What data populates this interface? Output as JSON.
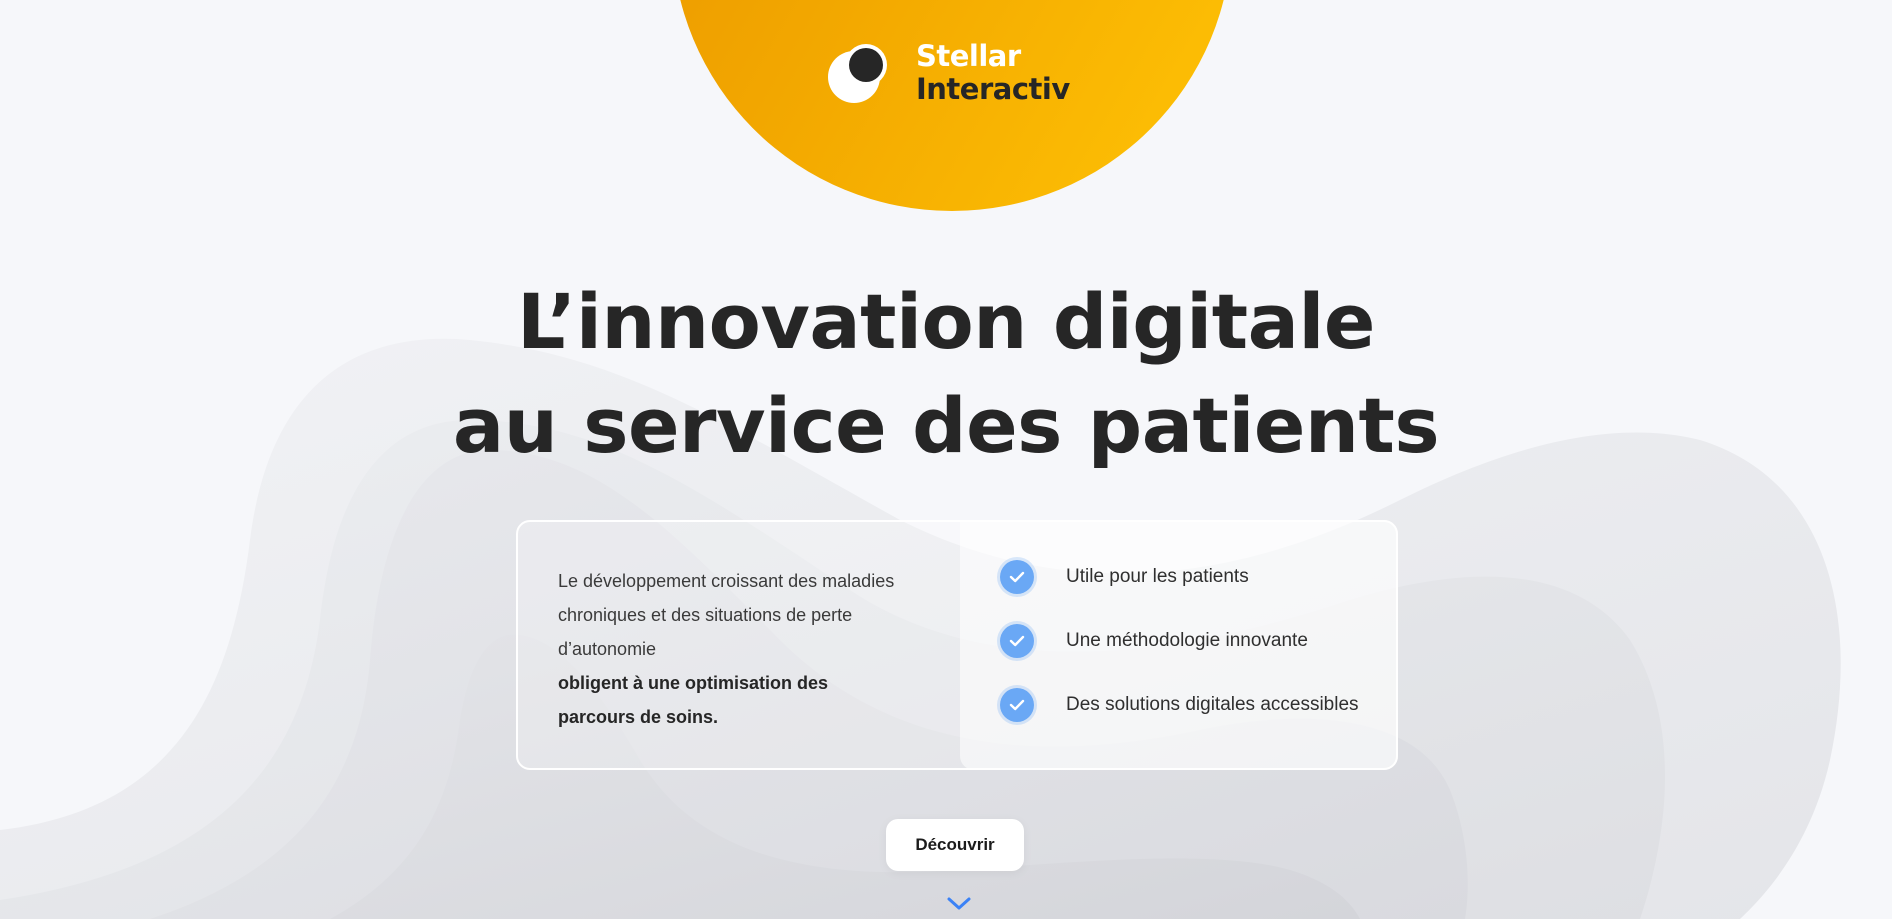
{
  "brand": {
    "name_line1": "Stellar",
    "name_line2": "Interactiv",
    "accent_color": "#f5a300",
    "logo_icon": "double-circle-logo-icon"
  },
  "hero": {
    "title_line1": "L’innovation digitale",
    "title_line2": "au service des patients"
  },
  "intro": {
    "text": "Le développement croissant des maladies chroniques et des situations de perte d’autonomie",
    "emphasis": "obligent à une optimisation des parcours de soins."
  },
  "features": [
    {
      "icon": "check-icon",
      "label": "Utile pour les patients"
    },
    {
      "icon": "check-icon",
      "label": "Une méthodologie innovante"
    },
    {
      "icon": "check-icon",
      "label": "Des solutions digitales accessibles"
    }
  ],
  "cta": {
    "label": "Découvrir",
    "scroll_icon": "chevron-down-icon",
    "icon_color": "#3b82f6"
  }
}
